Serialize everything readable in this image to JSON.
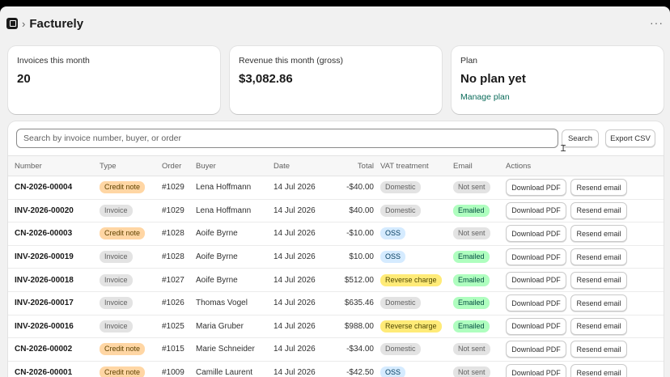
{
  "app": {
    "title": "Facturely",
    "separator": "›",
    "more": "···"
  },
  "stats": [
    {
      "label": "Invoices this month",
      "value": "20"
    },
    {
      "label": "Revenue this month (gross)",
      "value": "$3,082.86"
    },
    {
      "label": "Plan",
      "value": "No plan yet",
      "link": "Manage plan"
    }
  ],
  "toolbar": {
    "search_placeholder": "Search by invoice number, buyer, or order",
    "search_label": "Search",
    "export_label": "Export CSV"
  },
  "table": {
    "columns": [
      "Number",
      "Type",
      "Order",
      "Buyer",
      "Date",
      "Total",
      "VAT treatment",
      "Email",
      "Actions"
    ],
    "action_labels": {
      "pdf": "Download PDF",
      "resend": "Resend email"
    },
    "rows": [
      {
        "number": "CN-2026-00004",
        "type": "Credit note",
        "order": "#1029",
        "buyer": "Lena Hoffmann",
        "date": "14 Jul 2026",
        "total": "-$40.00",
        "vat": "Domestic",
        "email": "Not sent"
      },
      {
        "number": "INV-2026-00020",
        "type": "Invoice",
        "order": "#1029",
        "buyer": "Lena Hoffmann",
        "date": "14 Jul 2026",
        "total": "$40.00",
        "vat": "Domestic",
        "email": "Emailed"
      },
      {
        "number": "CN-2026-00003",
        "type": "Credit note",
        "order": "#1028",
        "buyer": "Aoife Byrne",
        "date": "14 Jul 2026",
        "total": "-$10.00",
        "vat": "OSS",
        "email": "Not sent"
      },
      {
        "number": "INV-2026-00019",
        "type": "Invoice",
        "order": "#1028",
        "buyer": "Aoife Byrne",
        "date": "14 Jul 2026",
        "total": "$10.00",
        "vat": "OSS",
        "email": "Emailed"
      },
      {
        "number": "INV-2026-00018",
        "type": "Invoice",
        "order": "#1027",
        "buyer": "Aoife Byrne",
        "date": "14 Jul 2026",
        "total": "$512.00",
        "vat": "Reverse charge",
        "email": "Emailed"
      },
      {
        "number": "INV-2026-00017",
        "type": "Invoice",
        "order": "#1026",
        "buyer": "Thomas Vogel",
        "date": "14 Jul 2026",
        "total": "$635.46",
        "vat": "Domestic",
        "email": "Emailed"
      },
      {
        "number": "INV-2026-00016",
        "type": "Invoice",
        "order": "#1025",
        "buyer": "Maria Gruber",
        "date": "14 Jul 2026",
        "total": "$988.00",
        "vat": "Reverse charge",
        "email": "Emailed"
      },
      {
        "number": "CN-2026-00002",
        "type": "Credit note",
        "order": "#1015",
        "buyer": "Marie Schneider",
        "date": "14 Jul 2026",
        "total": "-$34.00",
        "vat": "Domestic",
        "email": "Not sent"
      },
      {
        "number": "CN-2026-00001",
        "type": "Credit note",
        "order": "#1009",
        "buyer": "Camille Laurent",
        "date": "14 Jul 2026",
        "total": "-$42.50",
        "vat": "OSS",
        "email": "Not sent"
      }
    ]
  },
  "colors": {
    "type": {
      "Credit note": {
        "bg": "#ffd6a4",
        "fg": "#5e4200"
      },
      "Invoice": {
        "bg": "#e3e3e3",
        "fg": "#616161"
      }
    },
    "vat": {
      "Domestic": {
        "bg": "#e3e3e3",
        "fg": "#616161"
      },
      "OSS": {
        "bg": "#d5ebff",
        "fg": "#003a5a"
      },
      "Reverse charge": {
        "bg": "#ffeb78",
        "fg": "#4f4700"
      }
    },
    "email": {
      "Emailed": {
        "bg": "#affebf",
        "fg": "#014b40"
      },
      "Not sent": {
        "bg": "#e3e3e3",
        "fg": "#616161"
      }
    }
  }
}
